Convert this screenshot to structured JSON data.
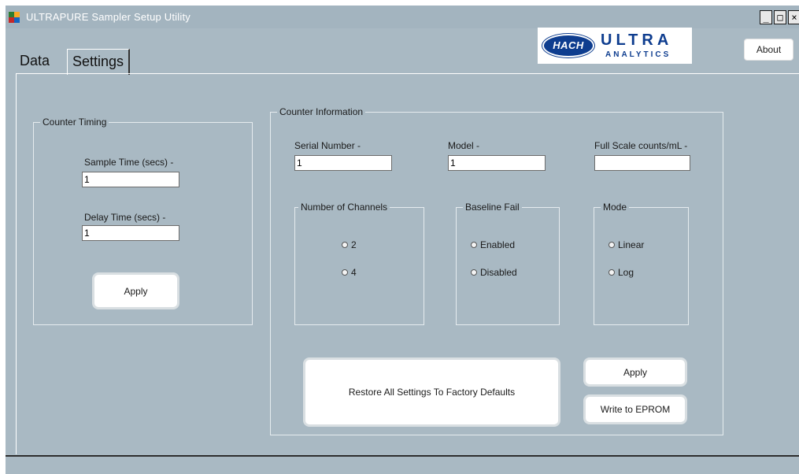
{
  "window": {
    "title": "ULTRAPURE Sampler Setup Utility",
    "controls": {
      "minimize": "_",
      "maximize": "□",
      "close": "×"
    },
    "icon_colors": [
      "#2e7d32",
      "#f9a825",
      "#c62828",
      "#1565c0"
    ]
  },
  "about_label": "About",
  "logo": {
    "brand": "HACH",
    "ultra": "ULTRA",
    "analytics": "ANALYTICS",
    "color": "#0e3d8f"
  },
  "tabs": [
    {
      "label": "Data",
      "active": false
    },
    {
      "label": "Settings",
      "active": true
    }
  ],
  "counter_timing": {
    "title": "Counter Timing",
    "sample_time_label": "Sample Time (secs) -",
    "sample_time_value": "1",
    "delay_time_label": "Delay Time (secs) -",
    "delay_time_value": "1",
    "apply_label": "Apply"
  },
  "counter_info": {
    "title": "Counter Information",
    "serial_label": "Serial Number -",
    "serial_value": "1",
    "model_label": "Model -",
    "model_value": "1",
    "fullscale_label": "Full Scale counts/mL -",
    "fullscale_value": "",
    "channels": {
      "title": "Number of Channels",
      "options": [
        "2",
        "4"
      ]
    },
    "baseline": {
      "title": "Baseline Fail",
      "options": [
        "Enabled",
        "Disabled"
      ]
    },
    "mode": {
      "title": "Mode",
      "options": [
        "Linear",
        "Log"
      ]
    },
    "restore_label": "Restore All Settings To Factory Defaults",
    "apply_label": "Apply",
    "write_label": "Write to EPROM"
  },
  "colors": {
    "background": "#a9b9c3",
    "titlebar": "#a3b4bf",
    "group_border": "#e6ecef"
  }
}
